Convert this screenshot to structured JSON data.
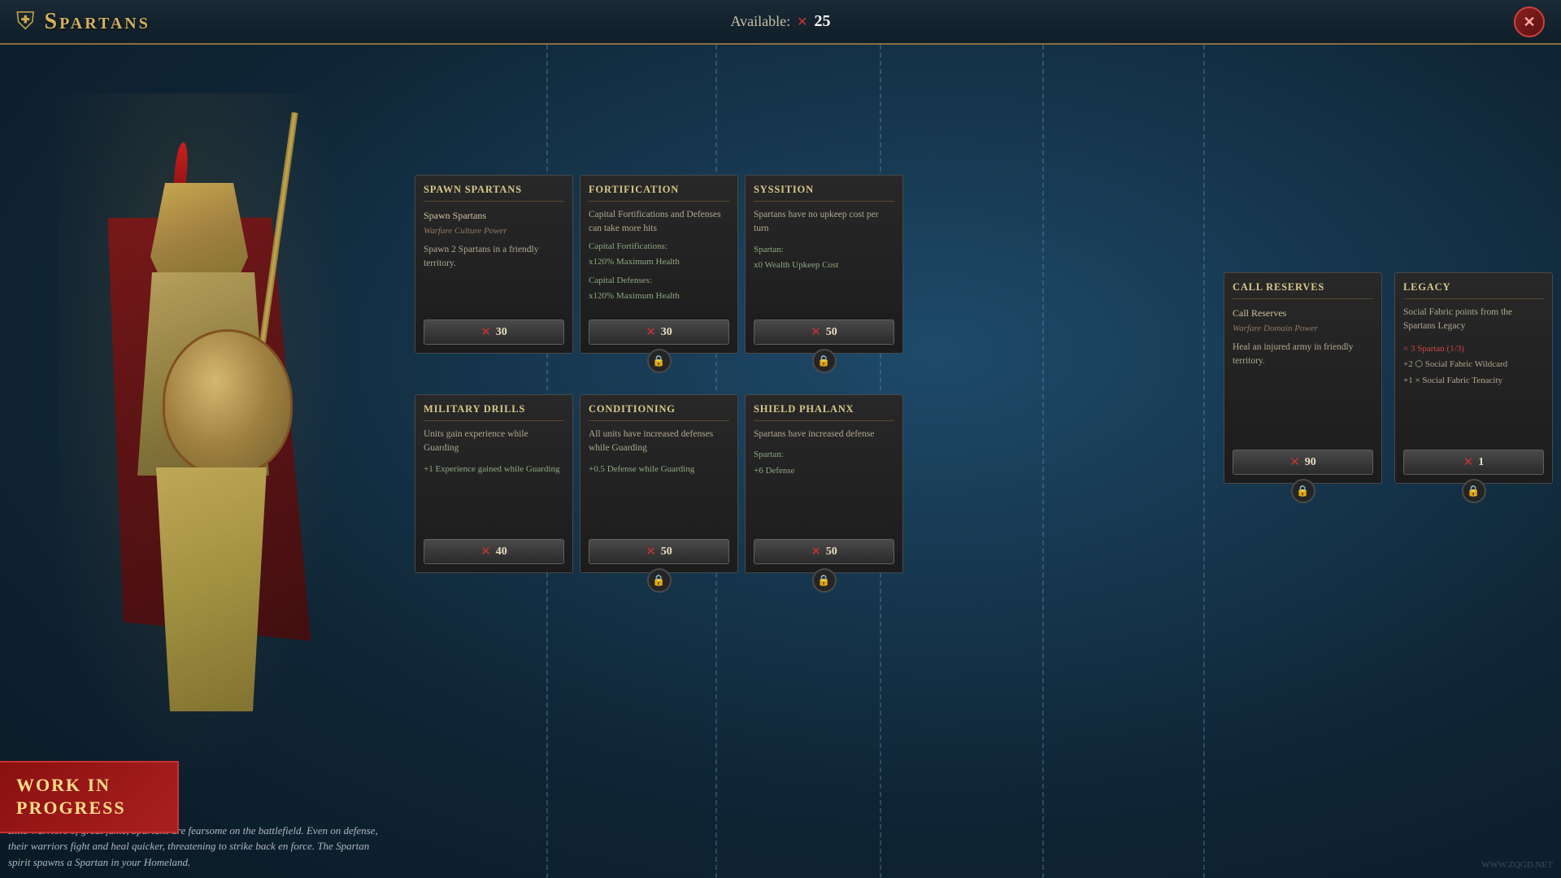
{
  "header": {
    "icon": "⛨",
    "title": "Spartans",
    "available_label": "Available:",
    "available_icon": "⚔",
    "available_count": "25",
    "close_label": "✕"
  },
  "cards": {
    "top_row": [
      {
        "id": "spawn-spartans",
        "title": "Spawn Spartans",
        "name": "Spawn Spartans",
        "subtitle": "Warfare Culture Power",
        "description": "Spawn 2 Spartans in a friendly territory.",
        "stats": [],
        "cost": "30",
        "locked": false
      },
      {
        "id": "fortification",
        "title": "Fortification",
        "name": "Capital Fortifications and Defenses can take more hits",
        "subtitle": "",
        "description": "",
        "stats": [
          "Capital Fortifications:",
          "x120% Maximum Health",
          "Capital Defenses:",
          "x120% Maximum Health"
        ],
        "cost": "30",
        "locked": true
      },
      {
        "id": "syssition",
        "title": "Syssition",
        "name": "Spartans have no upkeep cost per turn",
        "subtitle": "",
        "description": "",
        "stats": [
          "Spartan:",
          "x0 Wealth Upkeep Cost"
        ],
        "cost": "50",
        "locked": true
      }
    ],
    "bottom_row": [
      {
        "id": "military-drills",
        "title": "Military Drills",
        "name": "Units gain experience while Guarding",
        "subtitle": "",
        "description": "",
        "stats": [
          "+1 Experience gained while Guarding"
        ],
        "cost": "40",
        "locked": false
      },
      {
        "id": "conditioning",
        "title": "Conditioning",
        "name": "All units have increased defenses while Guarding",
        "subtitle": "",
        "description": "",
        "stats": [
          "+0.5 Defense while Guarding"
        ],
        "cost": "50",
        "locked": true
      },
      {
        "id": "shield-phalanx",
        "title": "Shield Phalanx",
        "name": "Spartans have increased defense",
        "subtitle": "",
        "description": "",
        "stats": [
          "Spartan:",
          "+6 Defense"
        ],
        "cost": "50",
        "locked": true
      }
    ],
    "right_col": {
      "id": "call-reserves",
      "title": "Call Reserves",
      "name": "Call Reserves",
      "subtitle": "Warfare Domain Power",
      "description": "Heal an injured army in friendly territory.",
      "stats": [],
      "cost": "90",
      "locked": true
    },
    "legacy_col": {
      "id": "legacy",
      "title": "Legacy",
      "name": "Social Fabric points from the Spartans Legacy",
      "subtitle": "",
      "description": "",
      "stats": [
        "× 3 Spartan (1/3)",
        "+2 ⬡ Social Fabric Wildcard",
        "+1 × Social Fabric Tenacity"
      ],
      "cost": "1",
      "locked": true
    }
  },
  "description": "Elite warriors of great fame, Spartans are fearsome on the battlefield. Even on defense, their warriors fight and heal quicker, threatening to strike back en force.\n\nThe Spartan spirit spawns a Spartan in your Homeland.",
  "wip": {
    "label": "Work In\nProgress"
  },
  "watermark": "WWW.ZQGD.NET"
}
